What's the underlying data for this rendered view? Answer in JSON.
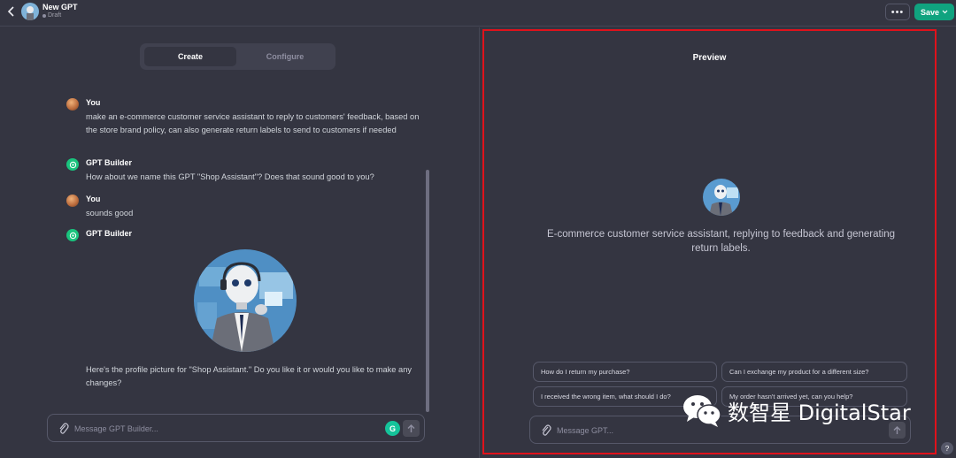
{
  "header": {
    "title": "New GPT",
    "status": "Draft",
    "save_label": "Save",
    "more_label": "•••"
  },
  "tabs": [
    {
      "label": "Create",
      "active": true
    },
    {
      "label": "Configure",
      "active": false
    }
  ],
  "messages": [
    {
      "author": "You",
      "text": "make an e-commerce customer service assistant to reply to customers' feedback, based on the store brand policy, can also generate return labels to send to customers if needed"
    },
    {
      "author": "GPT Builder",
      "text": "How about we name this GPT \"Shop Assistant\"? Does that sound good to you?"
    },
    {
      "author": "You",
      "text": "sounds good"
    },
    {
      "author": "GPT Builder",
      "text": "Here's the profile picture for \"Shop Assistant.\" Do you like it or would you like to make any changes?"
    }
  ],
  "builder_input": {
    "placeholder": "Message GPT Builder..."
  },
  "preview": {
    "title": "Preview",
    "description": "E-commerce customer service assistant, replying to feedback and generating return labels.",
    "starters": [
      "How do I return my purchase?",
      "Can I exchange my product for a different size?",
      "I received the wrong item, what should I do?",
      "My order hasn't arrived yet, can you help?"
    ],
    "input_placeholder": "Message GPT..."
  },
  "watermark": {
    "text": "数智星 DigitalStar"
  },
  "help_label": "?",
  "colors": {
    "background": "#343541",
    "accent": "#10a37f",
    "highlight_border": "#e0121b"
  }
}
